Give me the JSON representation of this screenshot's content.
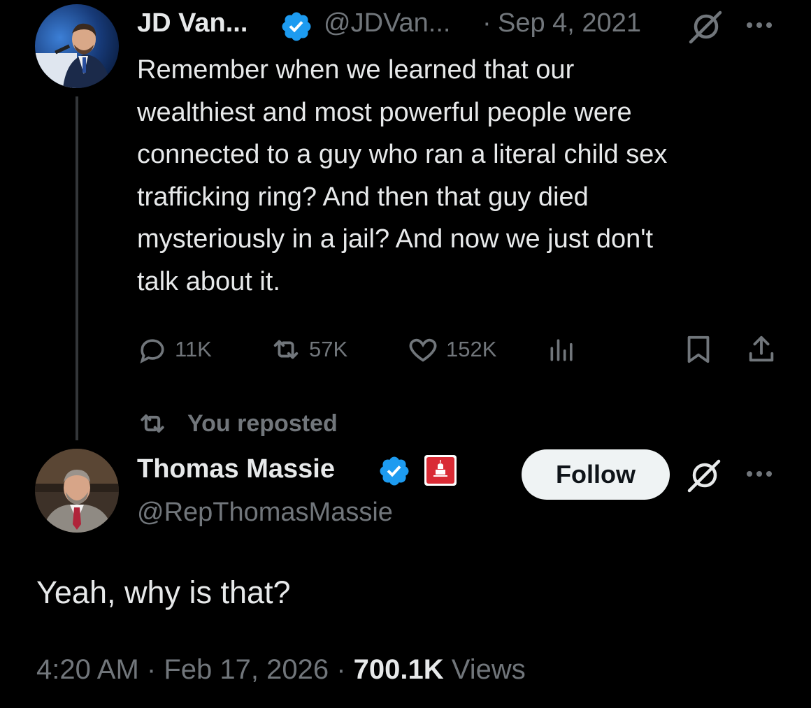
{
  "quoted_tweet": {
    "author_name": "JD Van...",
    "handle": "@JDVan...",
    "separator": "·",
    "date": "Sep 4, 2021",
    "text": "Remember when we learned that our wealthiest and most powerful people were connected to a guy who ran a literal child sex trafficking ring? And then that guy died mysteriously in a jail? And now we just don't talk about it.",
    "text_lines": [
      "Remember when we learned that our",
      "wealthiest and most powerful people were",
      "connected to a guy who ran a literal child sex",
      "trafficking ring? And then that guy died",
      "mysteriously in a jail? And now we just don't",
      "talk about it."
    ],
    "replies": "11K",
    "reposts": "57K",
    "likes": "152K"
  },
  "repost_banner": {
    "label": "You reposted"
  },
  "main_tweet": {
    "author_name": "Thomas Massie",
    "handle": "@RepThomasMassie",
    "follow_label": "Follow",
    "text": "Yeah, why is that?",
    "time": "4:20 AM",
    "sep1": "·",
    "date": "Feb 17, 2026",
    "sep2": "·",
    "views_count": "700.1K",
    "views_label": "Views"
  },
  "colors": {
    "background": "#000000",
    "text": "#e7e9ea",
    "muted": "#71767b",
    "verified_blue": "#1d9bf0",
    "gop_red": "#d92b35",
    "follow_bg": "#eff3f4"
  },
  "icons": [
    "verified-badge-icon",
    "grok-icon",
    "more-icon",
    "reply-icon",
    "repost-icon",
    "like-icon",
    "views-icon",
    "bookmark-icon",
    "share-icon",
    "gop-badge-icon"
  ]
}
